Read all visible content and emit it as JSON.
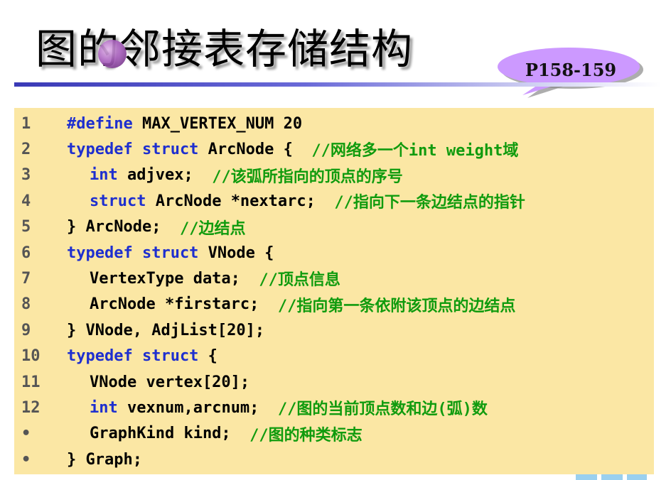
{
  "slide": {
    "title": "图的邻接表存储结构",
    "page_ref": "P158-159"
  },
  "code_lines": [
    {
      "num": "1",
      "indent": 0,
      "parts": [
        {
          "t": "kw",
          "s": "#define"
        },
        {
          "t": "tx",
          "s": " MAX_VERTEX_NUM 20"
        }
      ]
    },
    {
      "num": "2",
      "indent": 0,
      "parts": [
        {
          "t": "kw",
          "s": "typedef struct"
        },
        {
          "t": "tx",
          "s": " ArcNode {  "
        },
        {
          "t": "cm",
          "s": "//网络多一个int weight域"
        }
      ]
    },
    {
      "num": "3",
      "indent": 1,
      "parts": [
        {
          "t": "kw",
          "s": "int"
        },
        {
          "t": "tx",
          "s": " adjvex;  "
        },
        {
          "t": "cm",
          "s": "//该弧所指向的顶点的序号"
        }
      ]
    },
    {
      "num": "4",
      "indent": 1,
      "parts": [
        {
          "t": "kw",
          "s": "struct"
        },
        {
          "t": "tx",
          "s": " ArcNode *nextarc;  "
        },
        {
          "t": "cm",
          "s": "//指向下一条边结点的指针"
        }
      ]
    },
    {
      "num": "5",
      "indent": 0,
      "parts": [
        {
          "t": "tx",
          "s": "} ArcNode;  "
        },
        {
          "t": "cm",
          "s": "//边结点"
        }
      ]
    },
    {
      "num": "6",
      "indent": 0,
      "parts": [
        {
          "t": "kw",
          "s": "typedef struct"
        },
        {
          "t": "tx",
          "s": " VNode {"
        }
      ]
    },
    {
      "num": "7",
      "indent": 1,
      "parts": [
        {
          "t": "tx",
          "s": "VertexType data;  "
        },
        {
          "t": "cm",
          "s": "//顶点信息"
        }
      ]
    },
    {
      "num": "8",
      "indent": 1,
      "parts": [
        {
          "t": "tx",
          "s": "ArcNode *firstarc;  "
        },
        {
          "t": "cm",
          "s": "//指向第一条依附该顶点的边结点"
        }
      ]
    },
    {
      "num": "9",
      "indent": 0,
      "parts": [
        {
          "t": "tx",
          "s": "} VNode, AdjList[20];"
        }
      ]
    },
    {
      "num": "10",
      "indent": 0,
      "parts": [
        {
          "t": "kw",
          "s": "typedef struct"
        },
        {
          "t": "tx",
          "s": " {"
        }
      ]
    },
    {
      "num": "11",
      "indent": 1,
      "parts": [
        {
          "t": "tx",
          "s": "VNode vertex[20];"
        }
      ]
    },
    {
      "num": "12",
      "indent": 1,
      "parts": [
        {
          "t": "kw",
          "s": "int"
        },
        {
          "t": "tx",
          "s": " vexnum,arcnum;  "
        },
        {
          "t": "cm",
          "s": "//图的当前顶点数和边(弧)数"
        }
      ]
    },
    {
      "num": "•",
      "indent": 1,
      "parts": [
        {
          "t": "tx",
          "s": "GraphKind kind;  "
        },
        {
          "t": "cm",
          "s": "//图的种类标志"
        }
      ]
    },
    {
      "num": "•",
      "indent": 0,
      "parts": [
        {
          "t": "tx",
          "s": "} Graph;"
        }
      ]
    }
  ],
  "colors": {
    "keyword": "#1e2fcf",
    "comment": "#109b0e",
    "code_background": "#fbe7a4",
    "bubble_fill": "#cc99ff",
    "rule": "#3a3ab6"
  }
}
